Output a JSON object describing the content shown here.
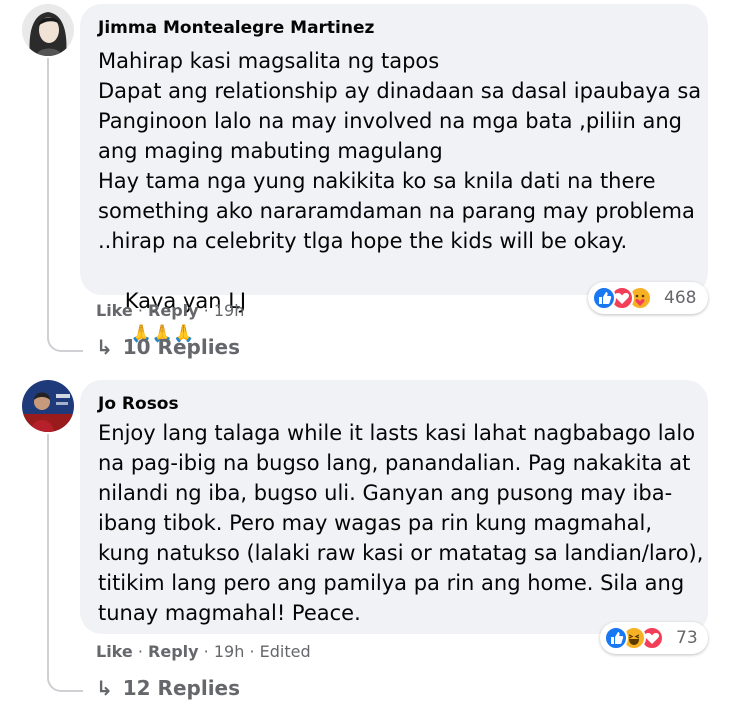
{
  "comments": [
    {
      "author": "Jimma Montealegre Martinez",
      "lines": [
        "Mahirap kasi magsalita ng tapos",
        "Dapat ang relationship ay dinadaan sa dasal ipaubaya sa",
        "Panginoon lalo na may involved na mga bata ,piliin ang",
        "ang maging mabuting magulang",
        "Hay tama nga yung nakikita ko sa knila dati na there",
        "something ako nararamdaman na parang may problema",
        "..hirap na celebrity tlga hope the kids will be okay.",
        "Kaya yan LJ"
      ],
      "emoji": "🙏🙏🙏",
      "reaction_icons": [
        "like-icon",
        "love-icon",
        "care-icon"
      ],
      "reaction_count": "468",
      "like_label": "Like",
      "reply_label": "Reply",
      "time": "19h",
      "replies_label": "10 Replies"
    },
    {
      "author": "Jo Rosos",
      "lines": [
        "Enjoy lang talaga while it lasts kasi lahat nagbabago lalo",
        "na pag-ibig na bugso lang, panandalian. Pag nakakita at",
        "nilandi ng iba, bugso uli. Ganyan ang pusong may iba-",
        "ibang tibok. Pero may wagas pa rin kung magmahal,",
        "kung natukso (lalaki raw kasi or matatag sa landian/laro),",
        "titikim lang pero ang pamilya pa rin ang home. Sila ang",
        "tunay magmahal! Peace."
      ],
      "reaction_icons": [
        "like-icon",
        "haha-icon",
        "love-icon"
      ],
      "reaction_count": "73",
      "like_label": "Like",
      "reply_label": "Reply",
      "time": "19h",
      "edited_label": "Edited",
      "replies_label": "12 Replies"
    }
  ],
  "colors": {
    "bubble": "#f0f2f5",
    "meta_text": "#65676b",
    "like_blue": "#1877f2",
    "love_red": "#f33e58",
    "haha_yellow": "#f7b125"
  }
}
